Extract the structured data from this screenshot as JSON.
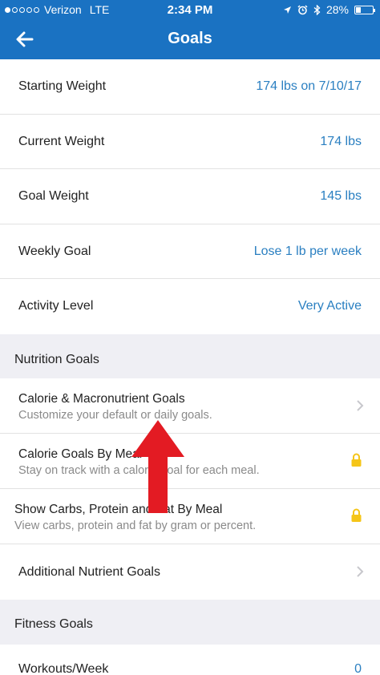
{
  "status": {
    "carrier": "Verizon",
    "network": "LTE",
    "time": "2:34 PM",
    "battery": "28%",
    "battery_level": 0.28
  },
  "nav": {
    "title": "Goals"
  },
  "weight_rows": [
    {
      "label": "Starting Weight",
      "value": "174 lbs on 7/10/17"
    },
    {
      "label": "Current Weight",
      "value": "174 lbs"
    },
    {
      "label": "Goal Weight",
      "value": "145 lbs"
    },
    {
      "label": "Weekly Goal",
      "value": "Lose 1 lb per week"
    },
    {
      "label": "Activity Level",
      "value": "Very Active"
    }
  ],
  "nutrition": {
    "header": "Nutrition Goals",
    "items": [
      {
        "title": "Calorie & Macronutrient Goals",
        "subtitle": "Customize your default or daily goals.",
        "icon": "chevron-right-icon"
      },
      {
        "title": "Calorie Goals By Meal",
        "subtitle": "Stay on track with a calorie goal for each meal.",
        "icon": "lock-icon"
      },
      {
        "title": "Show Carbs, Protein and Fat By Meal",
        "subtitle": "View carbs, protein and fat by gram or percent.",
        "icon": "lock-icon"
      },
      {
        "title": "Additional Nutrient Goals",
        "icon": "chevron-right-icon"
      }
    ]
  },
  "fitness": {
    "header": "Fitness Goals",
    "items": [
      {
        "label": "Workouts/Week",
        "value": "0"
      }
    ]
  },
  "colors": {
    "brand_blue": "#1a72c2",
    "value_blue": "#2a7fc1",
    "lock_yellow": "#f5c518",
    "annotation_red": "#e31b23"
  }
}
